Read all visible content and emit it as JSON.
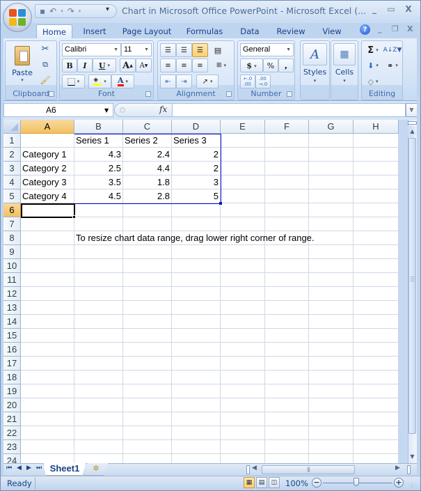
{
  "window": {
    "title": "Chart in Microsoft Office PowerPoint - Microsoft Excel (...",
    "minimize": "_",
    "maximize": "▭",
    "close": "X"
  },
  "quick_access": {
    "save_icon": "save-icon",
    "undo_icon": "undo-icon",
    "redo_icon": "redo-icon",
    "customize": "▾"
  },
  "ribbon_tabs": [
    {
      "label": "Home",
      "active": true
    },
    {
      "label": "Insert"
    },
    {
      "label": "Page Layout"
    },
    {
      "label": "Formulas"
    },
    {
      "label": "Data"
    },
    {
      "label": "Review"
    },
    {
      "label": "View"
    }
  ],
  "mdi": {
    "help": "?",
    "minimize": "_",
    "restore": "❐",
    "close": "X"
  },
  "ribbon": {
    "clipboard": {
      "label": "Clipboard",
      "paste": "Paste"
    },
    "font": {
      "label": "Font",
      "font_name": "Calibri",
      "font_size": "11",
      "bold": "B",
      "italic": "I",
      "underline": "U",
      "grow": "A",
      "shrink": "A",
      "fill_color": "#ffff00",
      "font_color": "#ff0000",
      "font_color_letter": "A"
    },
    "alignment": {
      "label": "Alignment"
    },
    "number": {
      "label": "Number",
      "format": "General",
      "currency": "$",
      "percent": "%",
      "comma": ",",
      "inc_decimal": ".0→.00",
      "dec_decimal": ".00→.0"
    },
    "styles": {
      "label": "Styles"
    },
    "cells": {
      "label": "Cells"
    },
    "editing": {
      "label": "Editing",
      "sum": "Σ"
    }
  },
  "formula_bar": {
    "name_box": "A6",
    "fx": "fx",
    "formula": "",
    "expand": "⌄"
  },
  "columns": [
    "A",
    "B",
    "C",
    "D",
    "E",
    "F",
    "G",
    "H"
  ],
  "active_column": "A",
  "rows": [
    "1",
    "2",
    "3",
    "4",
    "5",
    "6",
    "7",
    "8",
    "9",
    "10",
    "11",
    "12",
    "13",
    "14",
    "15",
    "16",
    "17",
    "18",
    "19",
    "20",
    "21",
    "22",
    "23",
    "24"
  ],
  "active_row": "6",
  "sheet": {
    "header_row": [
      "",
      "Series 1",
      "Series 2",
      "Series 3"
    ],
    "data_rows": [
      [
        "Category 1",
        "4.3",
        "2.4",
        "2"
      ],
      [
        "Category 2",
        "2.5",
        "4.4",
        "2"
      ],
      [
        "Category 3",
        "3.5",
        "1.8",
        "3"
      ],
      [
        "Category 4",
        "4.5",
        "2.8",
        "5"
      ]
    ],
    "note": "To resize chart data range, drag lower right corner of range.",
    "selected_cell": "A6"
  },
  "sheet_tabs": {
    "tabs": [
      "Sheet1"
    ],
    "active": "Sheet1"
  },
  "status_bar": {
    "status": "Ready",
    "zoom": "100%",
    "zoom_percent": 100,
    "view": "Normal"
  }
}
